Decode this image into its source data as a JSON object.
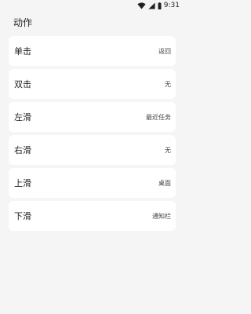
{
  "status_bar": {
    "time": "9:31"
  },
  "header": {
    "title": "动作"
  },
  "actions": [
    {
      "label": "单击",
      "value": "返回"
    },
    {
      "label": "双击",
      "value": "无"
    },
    {
      "label": "左滑",
      "value": "最近任务"
    },
    {
      "label": "右滑",
      "value": "无"
    },
    {
      "label": "上滑",
      "value": "桌面"
    },
    {
      "label": "下滑",
      "value": "通知栏"
    }
  ]
}
